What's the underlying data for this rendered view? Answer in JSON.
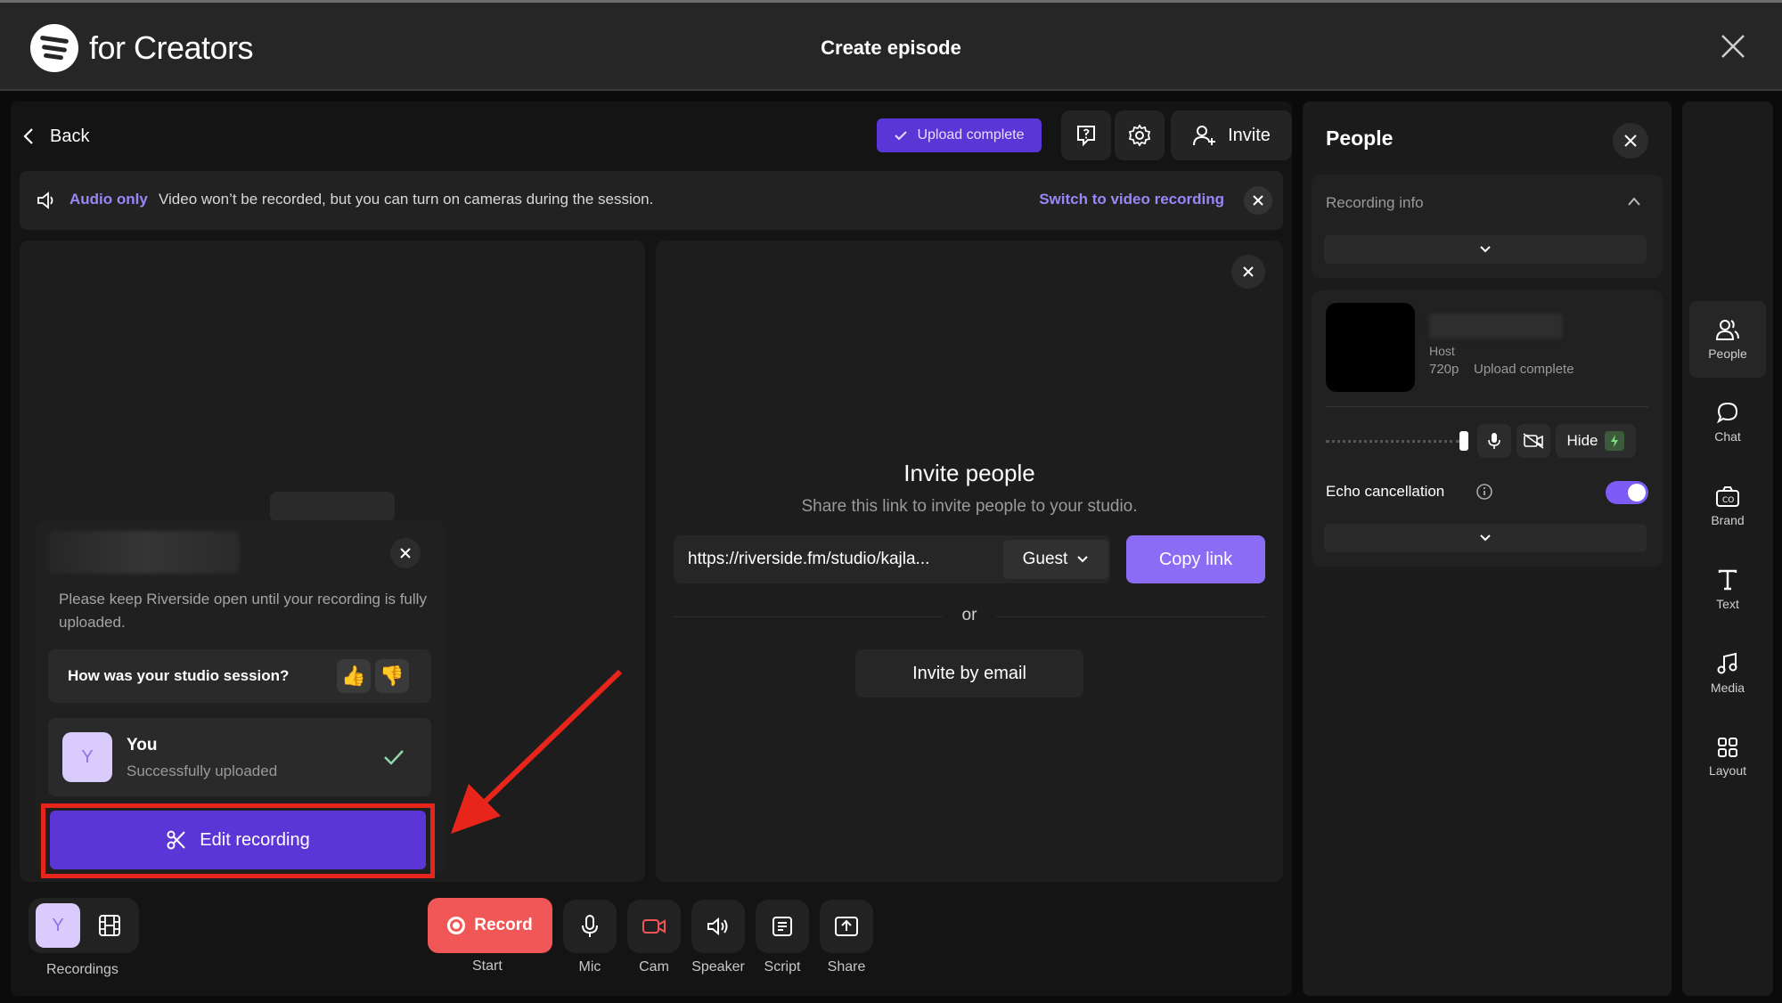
{
  "app": {
    "brand": "for Creators",
    "title": "Create episode"
  },
  "toolbar": {
    "back_label": "Back",
    "upload_status": "Upload complete",
    "invite_label": "Invite"
  },
  "banner": {
    "mode": "Audio only",
    "message": "Video won’t be recorded, but you can turn on cameras during the session.",
    "switch_link": "Switch to video recording"
  },
  "upload_popup": {
    "notice": "Please keep Riverside open until your recording is fully uploaded.",
    "feedback_question": "How was your studio session?",
    "participant_initial": "Y",
    "participant_name": "You",
    "participant_status": "Successfully uploaded",
    "edit_button": "Edit recording"
  },
  "invite": {
    "title": "Invite people",
    "subtitle": "Share this link to invite people to your studio.",
    "link": "https://riverside.fm/studio/kajla...",
    "role": "Guest",
    "copy_label": "Copy link",
    "or_label": "or",
    "email_label": "Invite by email"
  },
  "people_panel": {
    "title": "People",
    "recording_info": "Recording info",
    "role": "Host",
    "resolution": "720p",
    "upload_status": "Upload complete",
    "hide_label": "Hide",
    "echo_label": "Echo cancellation",
    "echo_enabled": true
  },
  "sidebar": {
    "items": [
      {
        "label": "People",
        "icon": "people-icon"
      },
      {
        "label": "Chat",
        "icon": "chat-icon"
      },
      {
        "label": "Brand",
        "icon": "brand-icon"
      },
      {
        "label": "Text",
        "icon": "text-icon"
      },
      {
        "label": "Media",
        "icon": "media-icon"
      },
      {
        "label": "Layout",
        "icon": "layout-icon"
      }
    ]
  },
  "bottom_bar": {
    "recordings_initial": "Y",
    "recordings_label": "Recordings",
    "record_label": "Record",
    "start_label": "Start",
    "mic_label": "Mic",
    "cam_label": "Cam",
    "speaker_label": "Speaker",
    "script_label": "Script",
    "share_label": "Share"
  },
  "colors": {
    "accent": "#7c5cf5",
    "accent_dark": "#5b35d5",
    "record_red": "#f25757",
    "annotation_red": "#e8251b",
    "background": "#0b0b0b",
    "panel": "#1b1b1b"
  }
}
